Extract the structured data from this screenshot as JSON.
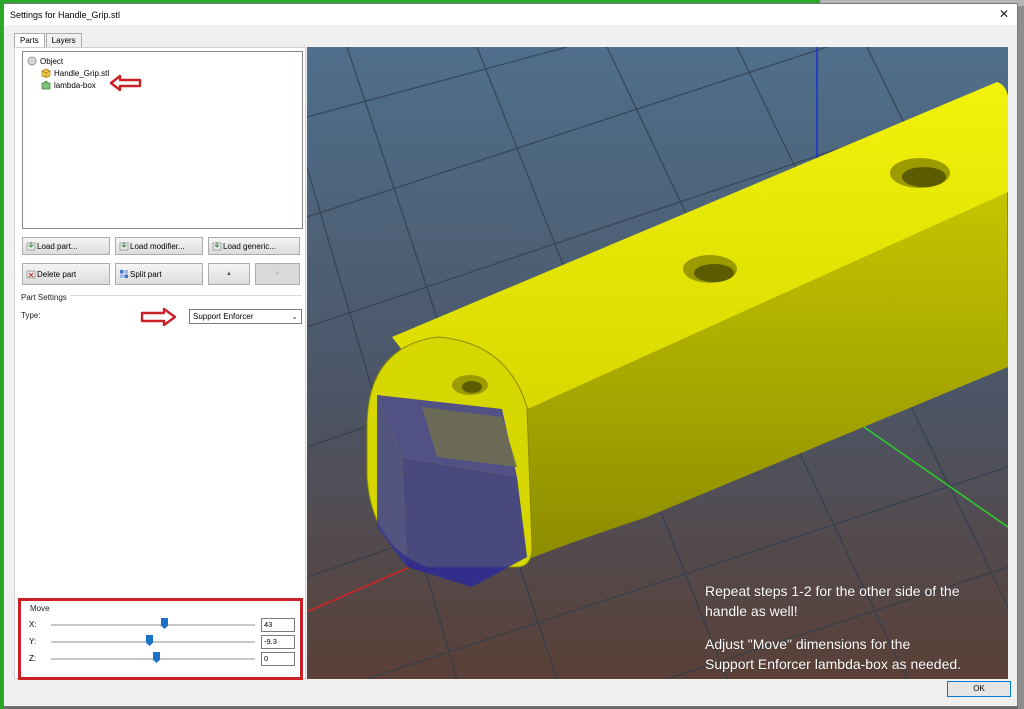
{
  "window": {
    "title": "Settings for Handle_Grip.stl"
  },
  "tabs": [
    {
      "label": "Parts",
      "active": true
    },
    {
      "label": "Layers",
      "active": false
    }
  ],
  "tree": {
    "root": "Object",
    "items": [
      {
        "label": "Handle_Grip.stl",
        "icon": "cube-icon"
      },
      {
        "label": "lambda-box",
        "icon": "puzzle-icon"
      }
    ]
  },
  "buttons": {
    "load_part": "Load part...",
    "load_modifier": "Load modifier...",
    "load_generic": "Load generic...",
    "delete_part": "Delete part",
    "split_part": "Split part",
    "move_up": "▲",
    "move_down": "▼"
  },
  "part_settings": {
    "title": "Part Settings",
    "type_label": "Type:",
    "type_value": "Support Enforcer"
  },
  "move": {
    "title": "Move",
    "axes": [
      {
        "label": "X:",
        "value": "43"
      },
      {
        "label": "Y:",
        "value": "-9.3"
      },
      {
        "label": "Z:",
        "value": "0"
      }
    ]
  },
  "caption": {
    "line1": "Repeat steps 1-2 for the other side of the",
    "line2": "handle as well!",
    "line3": "Adjust \"Move\" dimensions  for the",
    "line4": "Support Enforcer lambda-box as needed."
  },
  "ok_label": "OK",
  "colors": {
    "annotation_red": "#cc2027",
    "model_yellow": "#e6e600",
    "enforcer_blue": "#2b2b9a"
  }
}
